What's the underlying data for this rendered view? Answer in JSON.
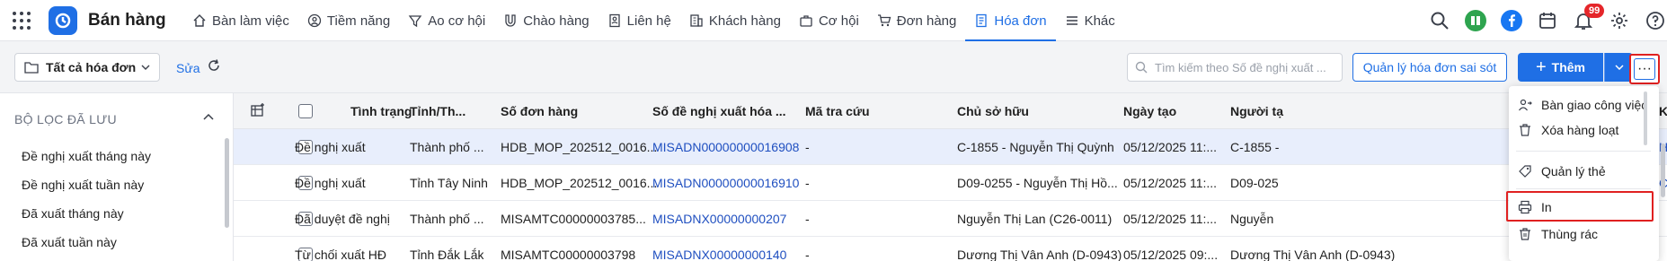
{
  "app": {
    "title": "Bán hàng"
  },
  "nav": [
    {
      "label": "Bàn làm việc",
      "icon": "home-icon"
    },
    {
      "label": "Tiềm năng",
      "icon": "user-circle-icon"
    },
    {
      "label": "Ao cơ hội",
      "icon": "funnel-icon"
    },
    {
      "label": "Chào hàng",
      "icon": "magnet-icon"
    },
    {
      "label": "Liên hệ",
      "icon": "contact-icon"
    },
    {
      "label": "Khách hàng",
      "icon": "building-icon"
    },
    {
      "label": "Cơ hội",
      "icon": "briefcase-icon"
    },
    {
      "label": "Đơn hàng",
      "icon": "cart-icon"
    },
    {
      "label": "Hóa đơn",
      "icon": "invoice-icon",
      "active": true
    },
    {
      "label": "Khác",
      "icon": "menu-icon"
    }
  ],
  "topright": {
    "notification_count": "99",
    "accent": "#1f6fe5"
  },
  "toolbar": {
    "view_label": "Tất cả hóa đơn",
    "edit_label": "Sửa",
    "search_placeholder": "Tìm kiếm theo Số đề nghị xuất ...",
    "manage_errors_label": "Quản lý hóa đơn sai sót",
    "add_label": "Thêm"
  },
  "sidebar": {
    "heading": "BỘ LỌC ĐÃ LƯU",
    "items": [
      "Đề nghị xuất tháng này",
      "Đề nghị xuất tuần này",
      "Đã xuất tháng này",
      "Đã xuất tuần này"
    ]
  },
  "grid": {
    "columns": [
      "Tình trạng",
      "Tỉnh/Th...",
      "Số đơn hàng",
      "Số đề nghị xuất hóa ...",
      "Mã tra cứu",
      "Chủ sở hữu",
      "Ngày tạo",
      "Người tạ",
      "Kh"
    ],
    "rows": [
      [
        "Đề nghị xuất",
        "Thành phố ...",
        "HDB_MOP_202512_0016...",
        "MISADN00000000016908",
        "-",
        "C-1855 - Nguyễn Thị Quỳnh",
        "05/12/2025 11:...",
        "C-1855 -",
        "Hộ"
      ],
      [
        "Đề nghị xuất",
        "Tỉnh Tây Ninh",
        "HDB_MOP_202512_0016...",
        "MISADN00000000016910",
        "-",
        "D09-0255 - Nguyễn Thị Hồ...",
        "05/12/2025 11:...",
        "D09-025",
        "CÔ"
      ],
      [
        "Đã duyệt đề nghị",
        "Thành phố ...",
        "MISAMTC00000003785...",
        "MISADNX00000000207",
        "-",
        "Nguyễn Thị Lan (C26-0011)",
        "05/12/2025 11:...",
        "Nguyễn",
        ""
      ],
      [
        "Từ chối xuất HĐ",
        "Tỉnh Đắk Lắk",
        "MISAMTC00000003798",
        "MISADNX00000000140",
        "-",
        "Dương Thị Vân Anh (D-0943)",
        "05/12/2025 09:...",
        "Dương Thị Vân Anh (D-0943)",
        ""
      ]
    ]
  },
  "menu": {
    "items": [
      "Bàn giao công việc",
      "Xóa hàng loạt",
      "Quản lý thẻ",
      "In",
      "Thùng rác"
    ]
  }
}
